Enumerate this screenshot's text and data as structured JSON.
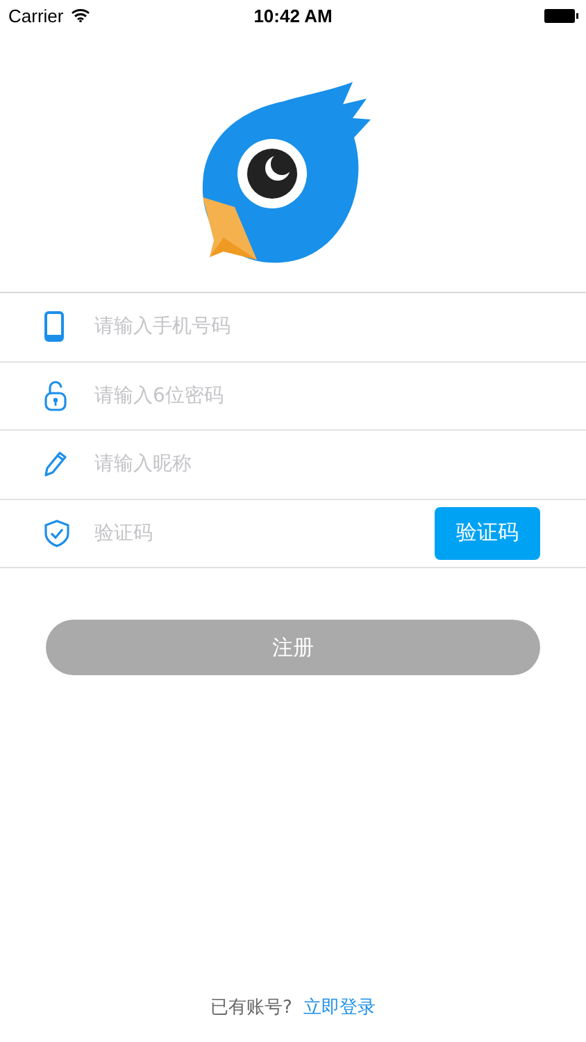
{
  "status_bar": {
    "carrier": "Carrier",
    "time": "10:42 AM"
  },
  "fields": [
    {
      "kind": "phone",
      "placeholder": "请输入手机号码"
    },
    {
      "kind": "lock",
      "placeholder": "请输入6位密码"
    },
    {
      "kind": "pencil",
      "placeholder": "请输入昵称"
    },
    {
      "kind": "shield",
      "placeholder": "验证码",
      "button": "验证码"
    }
  ],
  "register_button": {
    "label": "注册",
    "disabled": true
  },
  "footer": {
    "prompt": "已有账号?",
    "link": "立即登录"
  }
}
